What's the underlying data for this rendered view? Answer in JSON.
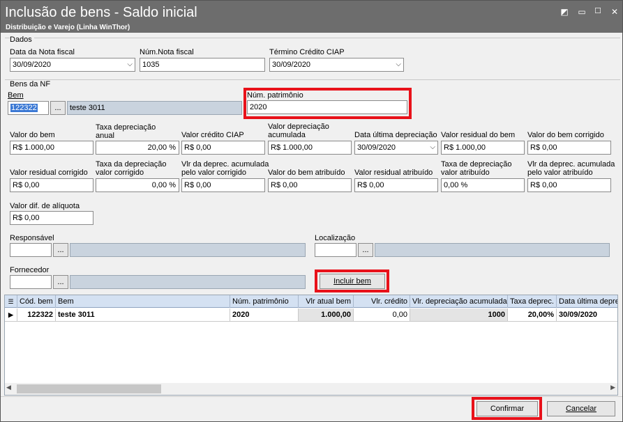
{
  "window": {
    "title": "Inclusão de bens - Saldo inicial",
    "subtitle": "Distribuição e Varejo (Linha WinThor)",
    "buttons": {
      "restore": "◩",
      "minimize": "▭",
      "close": "✕"
    }
  },
  "dados": {
    "group_label": "Dados",
    "data_nf_label": "Data da Nota fiscal",
    "data_nf_value": "30/09/2020",
    "num_nf_label": "Núm.Nota fiscal",
    "num_nf_value": "1035",
    "termino_label": "Término Crédito CIAP",
    "termino_value": "30/09/2020"
  },
  "bens": {
    "group_label": "Bens da NF",
    "bem_label": "Bem",
    "bem_code": "122322",
    "bem_button": "...",
    "bem_desc": "teste 3011",
    "num_patrimonio_label": "Núm. patrimônio",
    "num_patrimonio_value": "2020"
  },
  "fields_row1": [
    {
      "label": "Valor do bem",
      "value": "R$ 1.000,00"
    },
    {
      "label": "Taxa depreciação anual",
      "label1": "Taxa depreciação",
      "label2": "anual",
      "value": "20,00 %"
    },
    {
      "label": "Valor crédito CIAP",
      "value": "R$ 0,00"
    },
    {
      "label1": "Valor depreciação",
      "label2": "acumulada",
      "value": "R$ 1.000,00"
    },
    {
      "label": "Data última depreciação",
      "value": "30/09/2020"
    },
    {
      "label": "Valor residual do bem",
      "value": "R$ 1.000,00"
    },
    {
      "label": "Valor do bem corrigido",
      "value": "R$ 0,00"
    }
  ],
  "fields_row2": [
    {
      "label": "Valor residual corrigido",
      "value": "R$ 0,00"
    },
    {
      "label1": "Taxa da depreciação",
      "label2": "valor corrigido",
      "value": "0,00 %"
    },
    {
      "label1": "Vlr da deprec. acumulada",
      "label2": "pelo valor corrigido",
      "value": "R$ 0,00"
    },
    {
      "label": "Valor do bem atribuído",
      "value": "R$ 0,00"
    },
    {
      "label": "Valor residual atribuído",
      "value": "R$ 0,00"
    },
    {
      "label1": "Taxa de depreciação",
      "label2": "valor atribuído",
      "value": "0,00 %"
    },
    {
      "label1": "Vlr da deprec. acumulada",
      "label2": "pelo valor atribuído",
      "value": "R$ 0,00"
    }
  ],
  "valor_dif": {
    "label": "Valor dif. de alíquota",
    "value": "R$ 0,00"
  },
  "responsavel": {
    "label": "Responsável",
    "button": "..."
  },
  "localizacao": {
    "label": "Localização",
    "button": "..."
  },
  "fornecedor": {
    "label": "Fornecedor",
    "button": "..."
  },
  "incluir_bem": "Incluir bem",
  "grid": {
    "columns": [
      "Cód. bem",
      "Bem",
      "Núm. patrimônio",
      "Vlr atual bem",
      "Vlr. crédito",
      "Vlr. depreciação acumulada",
      "Taxa deprec.",
      "Data última deprec"
    ],
    "rows": [
      [
        "122322",
        "teste 3011",
        "2020",
        "1.000,00",
        "0,00",
        "1000",
        "20,00%",
        "30/09/2020"
      ]
    ]
  },
  "footer": {
    "confirmar": "Confirmar",
    "cancelar": "Cancelar"
  }
}
